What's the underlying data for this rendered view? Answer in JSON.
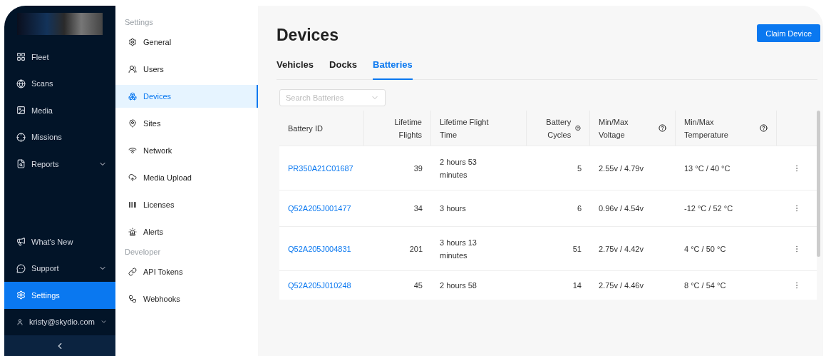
{
  "sidebar": {
    "nav": [
      {
        "label": "Fleet",
        "expandable": false,
        "selected": false
      },
      {
        "label": "Scans",
        "expandable": false,
        "selected": false
      },
      {
        "label": "Media",
        "expandable": false,
        "selected": false
      },
      {
        "label": "Missions",
        "expandable": false,
        "selected": false
      },
      {
        "label": "Reports",
        "expandable": true,
        "selected": false
      }
    ],
    "bottom": [
      {
        "label": "What's New",
        "expandable": false,
        "selected": false
      },
      {
        "label": "Support",
        "expandable": true,
        "selected": false
      },
      {
        "label": "Settings",
        "expandable": false,
        "selected": true
      },
      {
        "label": "kristy@skydio.com",
        "expandable": true,
        "selected": false
      }
    ]
  },
  "settings_menu": {
    "sections": [
      {
        "heading": "Settings",
        "items": [
          {
            "label": "General",
            "selected": false
          },
          {
            "label": "Users",
            "selected": false
          },
          {
            "label": "Devices",
            "selected": true
          },
          {
            "label": "Sites",
            "selected": false
          },
          {
            "label": "Network",
            "selected": false
          },
          {
            "label": "Media Upload",
            "selected": false
          },
          {
            "label": "Licenses",
            "selected": false
          },
          {
            "label": "Alerts",
            "selected": false
          }
        ]
      },
      {
        "heading": "Developer",
        "items": [
          {
            "label": "API Tokens",
            "selected": false
          },
          {
            "label": "Webhooks",
            "selected": false
          }
        ]
      }
    ]
  },
  "main": {
    "title": "Devices",
    "action_button": "Claim Device",
    "tabs": [
      {
        "label": "Vehicles",
        "selected": false
      },
      {
        "label": "Docks",
        "selected": false
      },
      {
        "label": "Batteries",
        "selected": true
      }
    ],
    "search": {
      "placeholder": "Search Batteries"
    },
    "table": {
      "columns": [
        {
          "label": "Battery ID",
          "help": false
        },
        {
          "label": "Lifetime Flights",
          "help": false
        },
        {
          "label": "Lifetime Flight Time",
          "help": false
        },
        {
          "label": "Battery Cycles",
          "help": true
        },
        {
          "label": "Min/Max Voltage",
          "help": true
        },
        {
          "label": "Min/Max Temperature",
          "help": true
        }
      ],
      "rows": [
        {
          "cells": [
            "PR350A21C01687",
            "39",
            "2 hours 53 minutes",
            "5",
            "2.55v / 4.79v",
            "13 °C / 40 °C"
          ]
        },
        {
          "cells": [
            "Q52A205J001477",
            "34",
            "3 hours",
            "6",
            "0.96v / 4.54v",
            "-12 °C / 52 °C"
          ]
        },
        {
          "cells": [
            "Q52A205J004831",
            "201",
            "3 hours 13 minutes",
            "51",
            "2.75v / 4.42v",
            "4 °C / 50 °C"
          ]
        },
        {
          "cells": [
            "Q52A205J010248",
            "45",
            "2 hours 58",
            "14",
            "2.75v / 4.46v",
            "8 °C / 54 °C"
          ]
        }
      ]
    }
  }
}
